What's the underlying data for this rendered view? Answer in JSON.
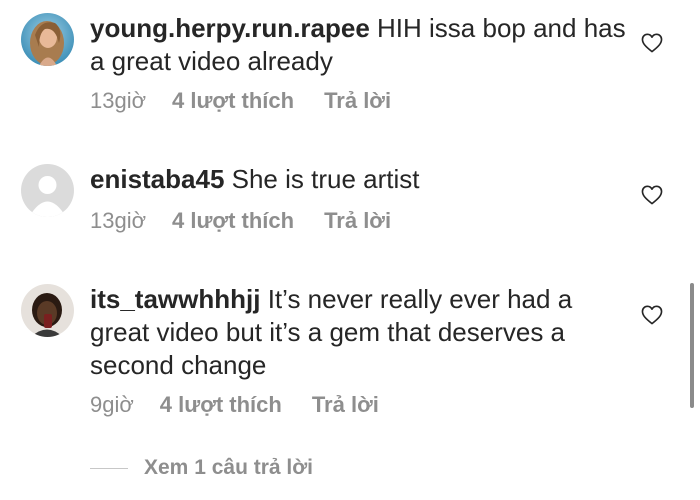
{
  "comments": [
    {
      "username": "young.herpy.run.rapee",
      "text": " HIH issa bop and has a great video already",
      "time": "13giờ",
      "likes": "4 lượt thích",
      "reply": "Trả lời"
    },
    {
      "username": "enistaba45",
      "text": " She  is  true  artist",
      "time": "13giờ",
      "likes": "4 lượt thích",
      "reply": "Trả lời"
    },
    {
      "username": "its_tawwhhhjj",
      "text": " It’s never really ever had a great video but it’s a gem that deserves a second change",
      "time": "9giờ",
      "likes": "4 lượt thích",
      "reply": "Trả lời"
    }
  ],
  "view_replies": "Xem 1 câu trả lời",
  "colors": {
    "primary_text": "#262626",
    "secondary_text": "#8e8e8e",
    "divider": "#c7c7c7"
  },
  "icons": {
    "like": "heart-outline-icon"
  }
}
